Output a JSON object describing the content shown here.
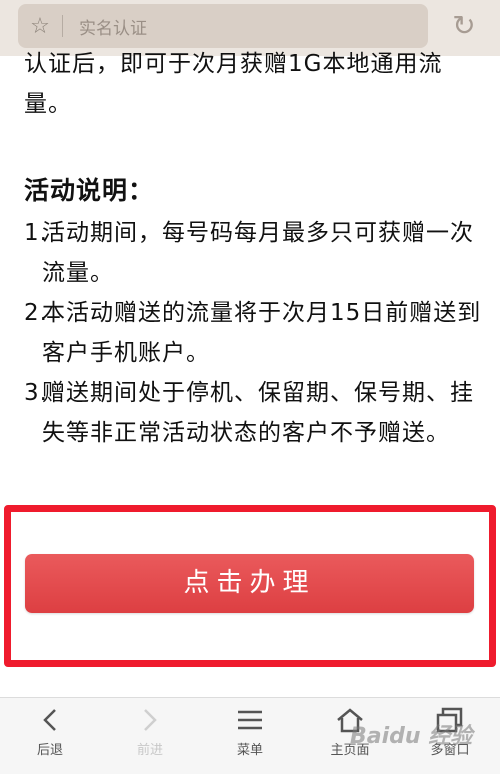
{
  "top_bar": {
    "title": "实名认证"
  },
  "article": {
    "partial_line_1": "认证后，即可于次月获赠1G本地通用流",
    "partial_line_2": "量。",
    "heading": "活动说明：",
    "items": [
      {
        "num": "1.",
        "text": "活动期间，每号码每月最多只可获赠一次流量。"
      },
      {
        "num": "2.",
        "text": "本活动赠送的流量将于次月15日前赠送到客户手机账户。"
      },
      {
        "num": "3.",
        "text": "赠送期间处于停机、保留期、保号期、挂失等非正常活动状态的客户不予赠送。"
      }
    ]
  },
  "cta_label": "点击办理",
  "bottom_nav": {
    "back": "后退",
    "forward": "前进",
    "menu": "菜单",
    "home": "主页面",
    "windows": "多窗口"
  },
  "watermark": "Baidu 经验",
  "colors": {
    "cta": "#e04a4c",
    "highlight_box": "#ef1b2d"
  }
}
